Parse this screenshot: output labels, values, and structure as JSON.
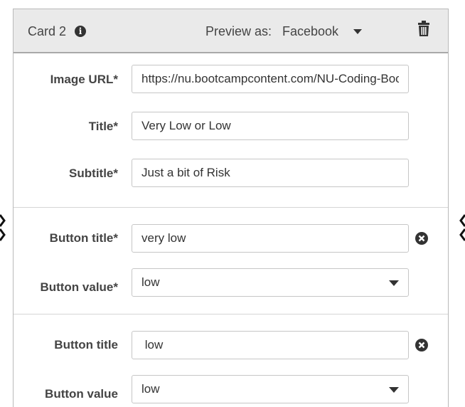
{
  "card": {
    "title": "Card 2",
    "info_icon": "info-icon",
    "preview_label": "Preview as:",
    "preview_value": "Facebook",
    "delete_icon": "trash-icon"
  },
  "fields": {
    "image_url": {
      "label": "Image URL*",
      "value": "https://nu.bootcampcontent.com/NU-Coding-Bootcamp"
    },
    "title": {
      "label": "Title*",
      "value": "Very Low or Low"
    },
    "subtitle": {
      "label": "Subtitle*",
      "value": "Just a bit of Risk"
    }
  },
  "buttons": [
    {
      "title_label": "Button title*",
      "title_value": "very low",
      "value_label": "Button value*",
      "value_selected": "low",
      "remove_icon": "remove-circle-icon"
    },
    {
      "title_label": "Button title",
      "title_value": " low",
      "value_label": "Button value",
      "value_selected": "low",
      "remove_icon": "remove-circle-icon"
    }
  ],
  "colors": {
    "header_bg": "#eaeaea",
    "border": "#c6c6c6",
    "text": "#333333"
  }
}
